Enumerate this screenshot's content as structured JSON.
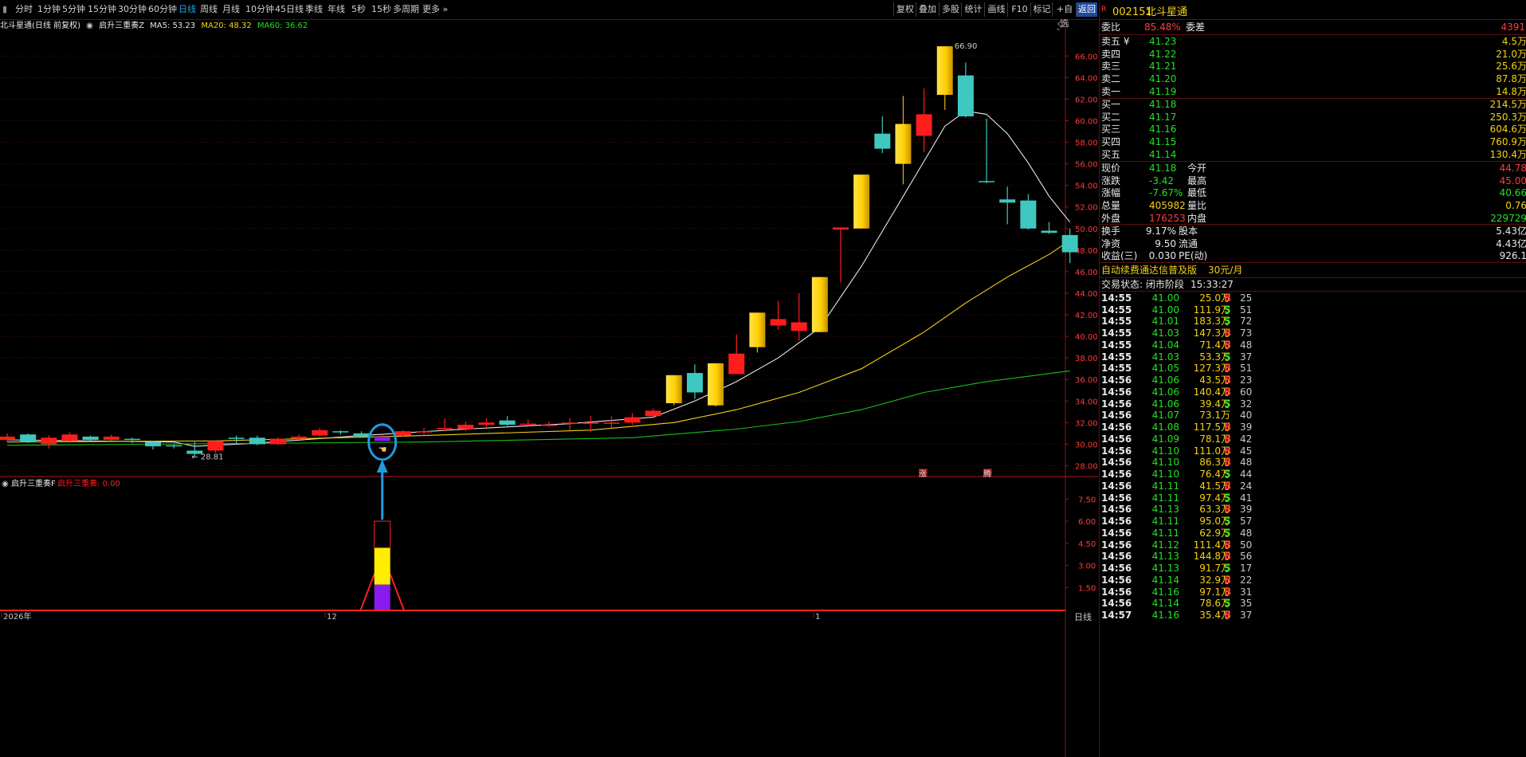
{
  "toolbar": {
    "periods": [
      "分时",
      "1分钟",
      "5分钟",
      "15分钟",
      "30分钟",
      "60分钟",
      "日线",
      "周线",
      "月线",
      "10分钟",
      "45日线",
      "季线",
      "年线",
      "5秒",
      "15秒",
      "多周期",
      "更多"
    ],
    "active_period": "日线",
    "buttons": [
      "复权",
      "叠加",
      "多股",
      "统计",
      "画线",
      "F10",
      "标记",
      "+自选",
      "返回"
    ]
  },
  "legend": {
    "title": "北斗星通(日线 前复权)",
    "indicator": "启升三重奏Z",
    "ma5": "MA5: 53.23",
    "ma20": "MA20: 48.32",
    "ma60": "MA60: 36.62"
  },
  "sub_legend": {
    "name": "启升三重奏F",
    "value": "启升三重奏: 0.00"
  },
  "chart_labels": {
    "high_label": "66.90",
    "low_label": "28.81",
    "mark_zhang": "涨",
    "mark_teng": "腾",
    "x_axis": [
      "2026年",
      "12",
      "1"
    ],
    "period_badge": "日线"
  },
  "chart_data": {
    "type": "candlestick",
    "ylim": [
      27,
      67.5
    ],
    "y_ticks": [
      "66.00",
      "64.00",
      "62.00",
      "60.00",
      "58.00",
      "56.00",
      "54.00",
      "52.00",
      "50.00",
      "48.00",
      "46.00",
      "44.00",
      "42.00",
      "40.00",
      "38.00",
      "36.00",
      "34.00",
      "32.00",
      "30.00",
      "28.00"
    ],
    "sub_ylim": [
      0,
      8.6
    ],
    "sub_ticks": [
      "7.50",
      "6.00",
      "4.50",
      "3.00",
      "1.50"
    ],
    "candles": [
      {
        "o": 30.4,
        "c": 30.7,
        "h": 31.0,
        "l": 30.2
      },
      {
        "o": 30.9,
        "c": 30.2,
        "h": 31.0,
        "l": 30.1
      },
      {
        "o": 30.0,
        "c": 30.6,
        "h": 30.8,
        "l": 29.6
      },
      {
        "o": 30.3,
        "c": 30.9,
        "h": 31.1,
        "l": 30.1
      },
      {
        "o": 30.7,
        "c": 30.4,
        "h": 30.8,
        "l": 30.3
      },
      {
        "o": 30.4,
        "c": 30.7,
        "h": 30.9,
        "l": 30.3
      },
      {
        "o": 30.5,
        "c": 30.4,
        "h": 30.6,
        "l": 30.1
      },
      {
        "o": 30.2,
        "c": 29.8,
        "h": 30.3,
        "l": 29.5
      },
      {
        "o": 29.9,
        "c": 29.8,
        "h": 30.0,
        "l": 29.6
      },
      {
        "o": 29.4,
        "c": 29.1,
        "h": 30.2,
        "l": 28.8
      },
      {
        "o": 29.4,
        "c": 30.3,
        "h": 30.3,
        "l": 29.2
      },
      {
        "o": 30.6,
        "c": 30.5,
        "h": 30.8,
        "l": 30.1
      },
      {
        "o": 30.6,
        "c": 30.0,
        "h": 30.8,
        "l": 29.9
      },
      {
        "o": 30.0,
        "c": 30.5,
        "h": 30.6,
        "l": 29.9
      },
      {
        "o": 30.5,
        "c": 30.7,
        "h": 30.9,
        "l": 30.4
      },
      {
        "o": 30.8,
        "c": 31.3,
        "h": 31.5,
        "l": 30.7
      },
      {
        "o": 31.2,
        "c": 31.1,
        "h": 31.3,
        "l": 30.9
      },
      {
        "o": 31.0,
        "c": 30.7,
        "h": 31.2,
        "l": 30.6
      },
      {
        "o": 30.3,
        "c": 30.7,
        "h": 30.9,
        "l": 30.3
      },
      {
        "o": 30.8,
        "c": 31.2,
        "h": 31.3,
        "l": 30.7
      },
      {
        "o": 31.1,
        "c": 31.2,
        "h": 31.5,
        "l": 30.8
      },
      {
        "o": 31.4,
        "c": 31.5,
        "h": 32.4,
        "l": 31.2
      },
      {
        "o": 31.4,
        "c": 31.8,
        "h": 32.1,
        "l": 31.2
      },
      {
        "o": 31.8,
        "c": 32.0,
        "h": 32.4,
        "l": 31.6
      },
      {
        "o": 32.2,
        "c": 31.8,
        "h": 32.6,
        "l": 31.7
      },
      {
        "o": 31.8,
        "c": 31.9,
        "h": 32.3,
        "l": 31.7
      },
      {
        "o": 31.8,
        "c": 31.8,
        "h": 32.1,
        "l": 31.6
      },
      {
        "o": 32.0,
        "c": 32.0,
        "h": 32.4,
        "l": 31.3
      },
      {
        "o": 31.9,
        "c": 32.0,
        "h": 32.6,
        "l": 31.1
      },
      {
        "o": 32.0,
        "c": 32.0,
        "h": 32.6,
        "l": 31.5
      },
      {
        "o": 32.0,
        "c": 32.5,
        "h": 32.9,
        "l": 31.8
      },
      {
        "o": 32.6,
        "c": 33.1,
        "h": 33.3,
        "l": 32.4
      },
      {
        "o": 33.8,
        "c": 36.4,
        "h": 36.4,
        "l": 33.6
      },
      {
        "o": 36.6,
        "c": 34.8,
        "h": 37.4,
        "l": 34.2
      },
      {
        "o": 33.6,
        "c": 37.5,
        "h": 37.5,
        "l": 33.5
      },
      {
        "o": 36.5,
        "c": 38.4,
        "h": 40.2,
        "l": 36.5
      },
      {
        "o": 39.0,
        "c": 42.2,
        "h": 42.2,
        "l": 38.5
      },
      {
        "o": 41.0,
        "c": 41.6,
        "h": 43.3,
        "l": 40.6
      },
      {
        "o": 40.5,
        "c": 41.3,
        "h": 44.0,
        "l": 39.6
      },
      {
        "o": 40.4,
        "c": 45.5,
        "h": 45.5,
        "l": 40.4
      },
      {
        "o": 49.9,
        "c": 50.1,
        "h": 50.1,
        "l": 45.0
      },
      {
        "o": 50.0,
        "c": 55.0,
        "h": 55.0,
        "l": 50.0
      },
      {
        "o": 58.8,
        "c": 57.4,
        "h": 60.4,
        "l": 57.0
      },
      {
        "o": 56.0,
        "c": 59.7,
        "h": 62.3,
        "l": 54.1
      },
      {
        "o": 58.6,
        "c": 60.6,
        "h": 63.0,
        "l": 57.1
      },
      {
        "o": 62.4,
        "c": 66.9,
        "h": 66.9,
        "l": 61.0
      },
      {
        "o": 64.2,
        "c": 60.4,
        "h": 65.4,
        "l": 60.3
      },
      {
        "o": 54.4,
        "c": 54.3,
        "h": 60.2,
        "l": 54.2
      },
      {
        "o": 52.7,
        "c": 52.4,
        "h": 53.9,
        "l": 50.4
      },
      {
        "o": 52.6,
        "c": 50.0,
        "h": 53.2,
        "l": 49.9
      },
      {
        "o": 49.8,
        "c": 49.6,
        "h": 50.6,
        "l": 49.5
      },
      {
        "o": 49.4,
        "c": 47.8,
        "h": 50.0,
        "l": 46.8
      }
    ],
    "ma_series": [
      {
        "name": "MA5",
        "color": "#e8e8e8",
        "values": [
          {
            "i": 0,
            "v": 30.4
          },
          {
            "i": 8,
            "v": 30.2
          },
          {
            "i": 9,
            "v": 29.8
          },
          {
            "i": 12,
            "v": 30.1
          },
          {
            "i": 17,
            "v": 30.8
          },
          {
            "i": 22,
            "v": 31.4
          },
          {
            "i": 27,
            "v": 31.9
          },
          {
            "i": 31,
            "v": 32.5
          },
          {
            "i": 33,
            "v": 34.0
          },
          {
            "i": 35,
            "v": 35.8
          },
          {
            "i": 37,
            "v": 38.0
          },
          {
            "i": 39,
            "v": 40.8
          },
          {
            "i": 41,
            "v": 46.5
          },
          {
            "i": 43,
            "v": 53.0
          },
          {
            "i": 45,
            "v": 59.5
          },
          {
            "i": 46,
            "v": 60.9
          },
          {
            "i": 47,
            "v": 60.6
          },
          {
            "i": 48,
            "v": 58.8
          },
          {
            "i": 49,
            "v": 56.1
          },
          {
            "i": 50,
            "v": 53.0
          },
          {
            "i": 51,
            "v": 50.6
          }
        ]
      },
      {
        "name": "MA20",
        "color": "#f5d214",
        "values": [
          {
            "i": 0,
            "v": 30.2
          },
          {
            "i": 10,
            "v": 30.3
          },
          {
            "i": 20,
            "v": 30.8
          },
          {
            "i": 28,
            "v": 31.3
          },
          {
            "i": 32,
            "v": 32.0
          },
          {
            "i": 35,
            "v": 33.2
          },
          {
            "i": 38,
            "v": 34.8
          },
          {
            "i": 41,
            "v": 37.0
          },
          {
            "i": 44,
            "v": 40.4
          },
          {
            "i": 46,
            "v": 43.1
          },
          {
            "i": 48,
            "v": 45.5
          },
          {
            "i": 50,
            "v": 47.6
          },
          {
            "i": 51,
            "v": 48.9
          }
        ]
      },
      {
        "name": "MA60",
        "color": "#18c018",
        "values": [
          {
            "i": 0,
            "v": 29.9
          },
          {
            "i": 20,
            "v": 30.2
          },
          {
            "i": 30,
            "v": 30.6
          },
          {
            "i": 35,
            "v": 31.4
          },
          {
            "i": 38,
            "v": 32.1
          },
          {
            "i": 41,
            "v": 33.2
          },
          {
            "i": 44,
            "v": 34.8
          },
          {
            "i": 47,
            "v": 35.8
          },
          {
            "i": 51,
            "v": 36.8
          }
        ]
      }
    ],
    "signal": {
      "candle_index": 18,
      "value": 6.0,
      "segments": [
        {
          "from": 0,
          "to": 1.7,
          "color": "#8a1bf0"
        },
        {
          "from": 1.7,
          "to": 4.2,
          "color": "#ffee00"
        },
        {
          "from": 4.2,
          "to": 6.0,
          "color": "#000000"
        }
      ]
    }
  },
  "quote": {
    "code": "002151",
    "name": "北斗星通",
    "weibi_label": "委比",
    "weibi": "85.48%",
    "weicha_label": "委差",
    "weicha": "4391",
    "sell": [
      {
        "label": "卖五",
        "price": "41.23",
        "vol": "4.5万"
      },
      {
        "label": "卖四",
        "price": "41.22",
        "vol": "21.0万"
      },
      {
        "label": "卖三",
        "price": "41.21",
        "vol": "25.6万"
      },
      {
        "label": "卖二",
        "price": "41.20",
        "vol": "87.8万"
      },
      {
        "label": "卖一",
        "price": "41.19",
        "vol": "14.8万"
      }
    ],
    "buy": [
      {
        "label": "买一",
        "price": "41.18",
        "vol": "214.5万"
      },
      {
        "label": "买二",
        "price": "41.17",
        "vol": "250.3万"
      },
      {
        "label": "买三",
        "price": "41.16",
        "vol": "604.6万"
      },
      {
        "label": "买四",
        "price": "41.15",
        "vol": "760.9万"
      },
      {
        "label": "买五",
        "price": "41.14",
        "vol": "130.4万"
      }
    ],
    "stats1": [
      {
        "l1": "现价",
        "v1": "41.18",
        "c1": "green",
        "l2": "今开",
        "v2": "44.78",
        "c2": "red"
      },
      {
        "l1": "涨跌",
        "v1": "-3.42",
        "c1": "green",
        "l2": "最高",
        "v2": "45.00",
        "c2": "red"
      },
      {
        "l1": "涨幅",
        "v1": "-7.67%",
        "c1": "green",
        "l2": "最低",
        "v2": "40.66",
        "c2": "green"
      },
      {
        "l1": "总量",
        "v1": "405982",
        "c1": "yellow",
        "l2": "量比",
        "v2": "0.76",
        "c2": "yellow"
      },
      {
        "l1": "外盘",
        "v1": "176253",
        "c1": "red",
        "l2": "内盘",
        "v2": "229729",
        "c2": "green"
      }
    ],
    "stats2": [
      {
        "l1": "换手",
        "v1": "9.17%",
        "l2": "股本",
        "v2": "5.43亿"
      },
      {
        "l1": "净资",
        "v1": "9.50",
        "l2": "流通",
        "v2": "4.43亿"
      },
      {
        "l1": "收益(三)",
        "v1": "0.030",
        "l2": "PE(动)",
        "v2": "926.1"
      }
    ],
    "ad_text": "自动续费通达信普及版",
    "ad_price": "30元/月",
    "status_label": "交易状态: 闭市阶段",
    "status_time": "15:33:27"
  },
  "ticks": [
    {
      "t": "14:55",
      "p": "41.00",
      "v": "25.0万",
      "d": "B",
      "n": "25"
    },
    {
      "t": "14:55",
      "p": "41.00",
      "v": "111.9万",
      "d": "S",
      "n": "51"
    },
    {
      "t": "14:55",
      "p": "41.01",
      "v": "183.3万",
      "d": "S",
      "n": "72"
    },
    {
      "t": "14:55",
      "p": "41.03",
      "v": "147.3万",
      "d": "B",
      "n": "73"
    },
    {
      "t": "14:55",
      "p": "41.04",
      "v": "71.4万",
      "d": "B",
      "n": "48"
    },
    {
      "t": "14:55",
      "p": "41.03",
      "v": "53.3万",
      "d": "S",
      "n": "37"
    },
    {
      "t": "14:55",
      "p": "41.05",
      "v": "127.3万",
      "d": "B",
      "n": "51"
    },
    {
      "t": "14:56",
      "p": "41.06",
      "v": "43.5万",
      "d": "B",
      "n": "23"
    },
    {
      "t": "14:56",
      "p": "41.06",
      "v": "140.4万",
      "d": "B",
      "n": "60"
    },
    {
      "t": "14:56",
      "p": "41.06",
      "v": "39.4万",
      "d": "S",
      "n": "32"
    },
    {
      "t": "14:56",
      "p": "41.07",
      "v": "73.1万",
      "d": "",
      "n": "40"
    },
    {
      "t": "14:56",
      "p": "41.08",
      "v": "117.5万",
      "d": "B",
      "n": "39"
    },
    {
      "t": "14:56",
      "p": "41.09",
      "v": "78.1万",
      "d": "B",
      "n": "42"
    },
    {
      "t": "14:56",
      "p": "41.10",
      "v": "111.0万",
      "d": "B",
      "n": "45"
    },
    {
      "t": "14:56",
      "p": "41.10",
      "v": "86.3万",
      "d": "B",
      "n": "48"
    },
    {
      "t": "14:56",
      "p": "41.10",
      "v": "76.4万",
      "d": "S",
      "n": "44"
    },
    {
      "t": "14:56",
      "p": "41.11",
      "v": "41.5万",
      "d": "B",
      "n": "24"
    },
    {
      "t": "14:56",
      "p": "41.11",
      "v": "97.4万",
      "d": "S",
      "n": "41"
    },
    {
      "t": "14:56",
      "p": "41.13",
      "v": "63.3万",
      "d": "B",
      "n": "39"
    },
    {
      "t": "14:56",
      "p": "41.11",
      "v": "95.0万",
      "d": "S",
      "n": "57"
    },
    {
      "t": "14:56",
      "p": "41.11",
      "v": "62.9万",
      "d": "S",
      "n": "48"
    },
    {
      "t": "14:56",
      "p": "41.12",
      "v": "111.4万",
      "d": "B",
      "n": "50"
    },
    {
      "t": "14:56",
      "p": "41.13",
      "v": "144.8万",
      "d": "B",
      "n": "56"
    },
    {
      "t": "14:56",
      "p": "41.13",
      "v": "91.7万",
      "d": "S",
      "n": "17"
    },
    {
      "t": "14:56",
      "p": "41.14",
      "v": "32.9万",
      "d": "B",
      "n": "22"
    },
    {
      "t": "14:56",
      "p": "41.16",
      "v": "97.1万",
      "d": "B",
      "n": "31"
    },
    {
      "t": "14:56",
      "p": "41.14",
      "v": "78.6万",
      "d": "S",
      "n": "35"
    },
    {
      "t": "14:57",
      "p": "41.16",
      "v": "35.4万",
      "d": "B",
      "n": "37"
    }
  ],
  "colors": {
    "up": "#ff1c1c",
    "down": "#3ec8c0",
    "grid": "#5a1010",
    "accent": "#22a6f2",
    "signal_arrow": "#1e9be0"
  }
}
